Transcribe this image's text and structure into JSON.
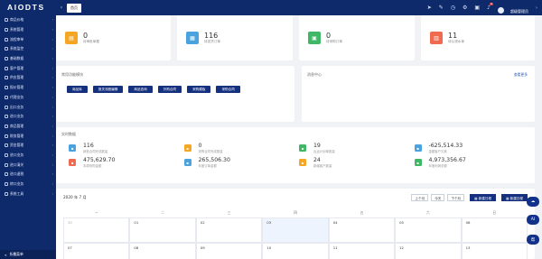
{
  "brand": {
    "logo": "AIODTS"
  },
  "sidebar": {
    "items": [
      {
        "label": "商品价格"
      },
      {
        "label": "系统管理"
      },
      {
        "label": "流程审单"
      },
      {
        "label": "系统监控"
      },
      {
        "label": "基础数据"
      },
      {
        "label": "客户管理"
      },
      {
        "label": "供应管理"
      },
      {
        "label": "报价管理"
      },
      {
        "label": "代理业务"
      },
      {
        "label": "出口业务"
      },
      {
        "label": "进口业务"
      },
      {
        "label": "商品管理"
      },
      {
        "label": "财务管理"
      },
      {
        "label": "资金管理"
      },
      {
        "label": "进口业务"
      },
      {
        "label": "进口清关"
      },
      {
        "label": "进口退税"
      },
      {
        "label": "转口业务"
      },
      {
        "label": "系统工具"
      }
    ],
    "footer": "折叠菜单"
  },
  "header": {
    "tab": "首页",
    "badge": "6",
    "user": "超级管理员",
    "icons": [
      "send-icon",
      "translate-icon",
      "clock-icon",
      "gear-icon",
      "lock-icon",
      "bell-icon",
      "avatar"
    ]
  },
  "stats": [
    {
      "value": "0",
      "label": "待审批单据",
      "color": "#f5a623",
      "icon": "inbox-icon"
    },
    {
      "value": "116",
      "label": "待发货订单",
      "color": "#4aa3df",
      "icon": "truck-icon"
    },
    {
      "value": "0",
      "label": "待采购订单",
      "color": "#3fb765",
      "icon": "cart-icon"
    },
    {
      "value": "11",
      "label": "待认领水单",
      "color": "#f06a4f",
      "icon": "receipt-icon"
    }
  ],
  "functions": {
    "title": "常用功能模块",
    "buttons": [
      "商品库",
      "报关流程编辑",
      "商品查询",
      "外购合同",
      "采购模板",
      "采购合同"
    ]
  },
  "messages": {
    "title": "消息中心",
    "more": "查看更多"
  },
  "realtime": {
    "title": "实时数据",
    "items": [
      {
        "value": "116",
        "label": "销售合同完成数量",
        "color": "#4aa3df"
      },
      {
        "value": "0",
        "label": "采购合同完成数量",
        "color": "#f5a623"
      },
      {
        "value": "19",
        "label": "出运计划单数量",
        "color": "#3fb765"
      },
      {
        "value": "-625,514.33",
        "label": "金额客户欠款",
        "color": "#4aa3df"
      },
      {
        "value": "475,629.70",
        "label": "本周采购金额",
        "color": "#f06a4f"
      },
      {
        "value": "265,506.30",
        "label": "年度订单金额",
        "color": "#4aa3df"
      },
      {
        "value": "24",
        "label": "新增客户数量",
        "color": "#f5a623"
      },
      {
        "value": "4,973,356.67",
        "label": "年度利润总额",
        "color": "#3fb765"
      }
    ]
  },
  "calendar": {
    "title": "2020 年 7 月",
    "buttons": [
      "上个月",
      "今天",
      "下个月"
    ],
    "action1": "新建日程",
    "action2": "新建日程",
    "weekdays": [
      "一",
      "二",
      "三",
      "四",
      "五",
      "六",
      "日"
    ],
    "row1": [
      "30",
      "01",
      "02",
      "03",
      "04",
      "05",
      "06"
    ],
    "row2": [
      "07",
      "08",
      "09",
      "10",
      "11",
      "12",
      "13"
    ]
  },
  "float_buttons": [
    "AI",
    "帮"
  ]
}
